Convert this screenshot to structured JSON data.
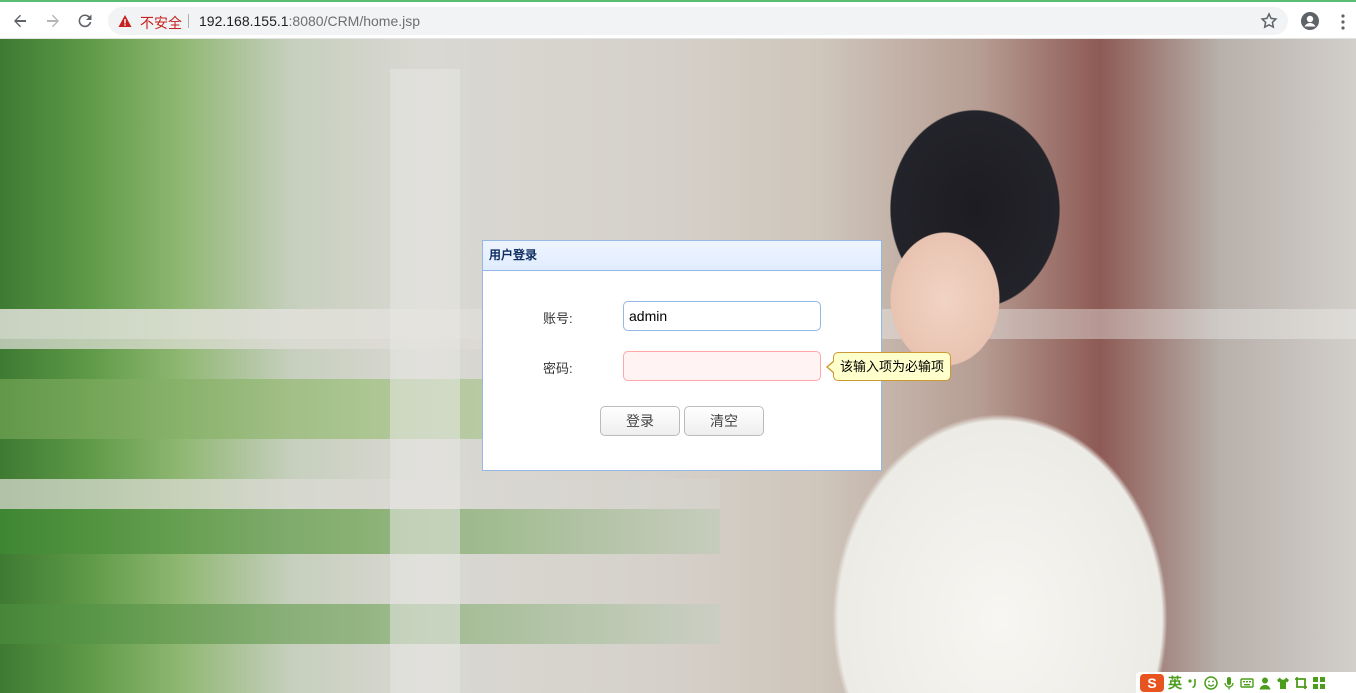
{
  "browser": {
    "insecure_label": "不安全",
    "url_host": "192.168.155.1",
    "url_rest": ":8080/CRM/home.jsp"
  },
  "dialog": {
    "title": "用户登录",
    "username_label": "账号:",
    "username_value": "admin",
    "password_label": "密码:",
    "password_value": "",
    "login_button": "登录",
    "clear_button": "清空"
  },
  "tooltip": {
    "text": "该输入项为必输项"
  },
  "ime": {
    "logo": "S",
    "language": "英",
    "icons": [
      "punctuation-icon",
      "emoji-icon",
      "microphone-icon",
      "keyboard-icon",
      "user-icon",
      "shirt-icon",
      "crop-icon",
      "grid-icon"
    ]
  },
  "colors": {
    "dialog_border": "#95b8e7",
    "dialog_header": "#e0ecff",
    "tooltip_bg": "#ffffcc",
    "ime_logo": "#e8541f",
    "ime_accent": "#4b9d1b",
    "insecure": "#c5221f"
  }
}
